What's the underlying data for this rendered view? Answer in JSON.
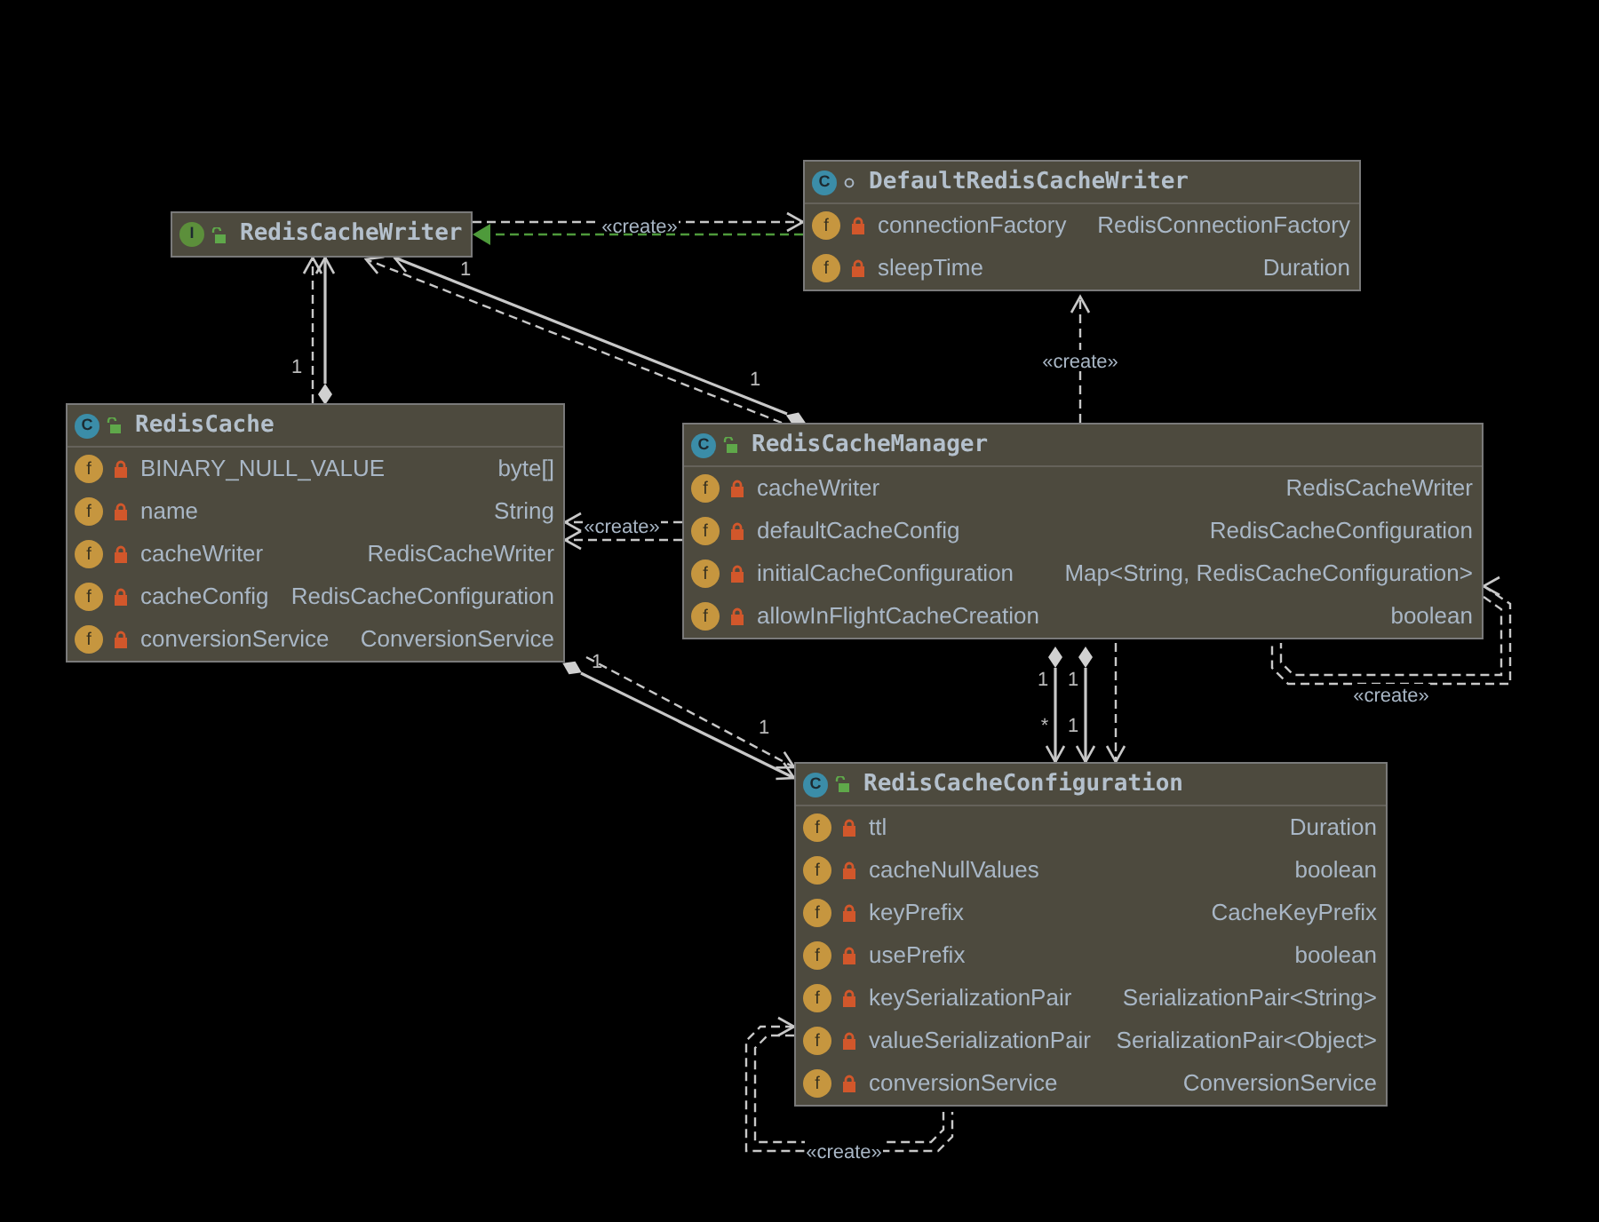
{
  "classes": [
    {
      "name": "RedisCacheWriter",
      "kind": "interface",
      "icon_letter": "I",
      "public": true
    },
    {
      "name": "DefaultRedisCacheWriter",
      "kind": "class",
      "icon_letter": "C",
      "public": false,
      "fields": [
        {
          "icon_letter": "f",
          "name": "connectionFactory",
          "type": "RedisConnectionFactory"
        },
        {
          "icon_letter": "f",
          "name": "sleepTime",
          "type": "Duration"
        }
      ]
    },
    {
      "name": "RedisCache",
      "kind": "class",
      "icon_letter": "C",
      "public": true,
      "fields": [
        {
          "icon_letter": "f",
          "name": "BINARY_NULL_VALUE",
          "type": "byte[]"
        },
        {
          "icon_letter": "f",
          "name": "name",
          "type": "String"
        },
        {
          "icon_letter": "f",
          "name": "cacheWriter",
          "type": "RedisCacheWriter"
        },
        {
          "icon_letter": "f",
          "name": "cacheConfig",
          "type": "RedisCacheConfiguration"
        },
        {
          "icon_letter": "f",
          "name": "conversionService",
          "type": "ConversionService"
        }
      ]
    },
    {
      "name": "RedisCacheManager",
      "kind": "class",
      "icon_letter": "C",
      "public": true,
      "fields": [
        {
          "icon_letter": "f",
          "name": "cacheWriter",
          "type": "RedisCacheWriter"
        },
        {
          "icon_letter": "f",
          "name": "defaultCacheConfig",
          "type": "RedisCacheConfiguration"
        },
        {
          "icon_letter": "f",
          "name": "initialCacheConfiguration",
          "type": "Map<String, RedisCacheConfiguration>"
        },
        {
          "icon_letter": "f",
          "name": "allowInFlightCacheCreation",
          "type": "boolean"
        }
      ]
    },
    {
      "name": "RedisCacheConfiguration",
      "kind": "class",
      "icon_letter": "C",
      "public": true,
      "fields": [
        {
          "icon_letter": "f",
          "name": "ttl",
          "type": "Duration"
        },
        {
          "icon_letter": "f",
          "name": "cacheNullValues",
          "type": "boolean"
        },
        {
          "icon_letter": "f",
          "name": "keyPrefix",
          "type": "CacheKeyPrefix"
        },
        {
          "icon_letter": "f",
          "name": "usePrefix",
          "type": "boolean"
        },
        {
          "icon_letter": "f",
          "name": "keySerializationPair",
          "type": "SerializationPair<String>"
        },
        {
          "icon_letter": "f",
          "name": "valueSerializationPair",
          "type": "SerializationPair<Object>"
        },
        {
          "icon_letter": "f",
          "name": "conversionService",
          "type": "ConversionService"
        }
      ]
    }
  ],
  "edges": [
    {
      "kind": "dependency",
      "label": "«create»"
    },
    {
      "kind": "realization"
    },
    {
      "kind": "composition",
      "multiplicities": [
        "1"
      ]
    },
    {
      "kind": "dependency"
    },
    {
      "kind": "composition",
      "multiplicities": [
        "1",
        "1"
      ]
    },
    {
      "kind": "dependency"
    },
    {
      "kind": "dependency",
      "label": "«create»"
    },
    {
      "kind": "dependency",
      "label": "«create»"
    },
    {
      "kind": "dependency"
    },
    {
      "kind": "composition",
      "multiplicities": [
        "1",
        "1"
      ]
    },
    {
      "kind": "dependency"
    },
    {
      "kind": "composition",
      "multiplicities": [
        "1",
        "*"
      ]
    },
    {
      "kind": "composition",
      "multiplicities": [
        "1",
        "1"
      ]
    },
    {
      "kind": "dependency"
    },
    {
      "kind": "self_dependency",
      "label": "«create»"
    },
    {
      "kind": "self_dependency",
      "label": "«create»"
    }
  ]
}
